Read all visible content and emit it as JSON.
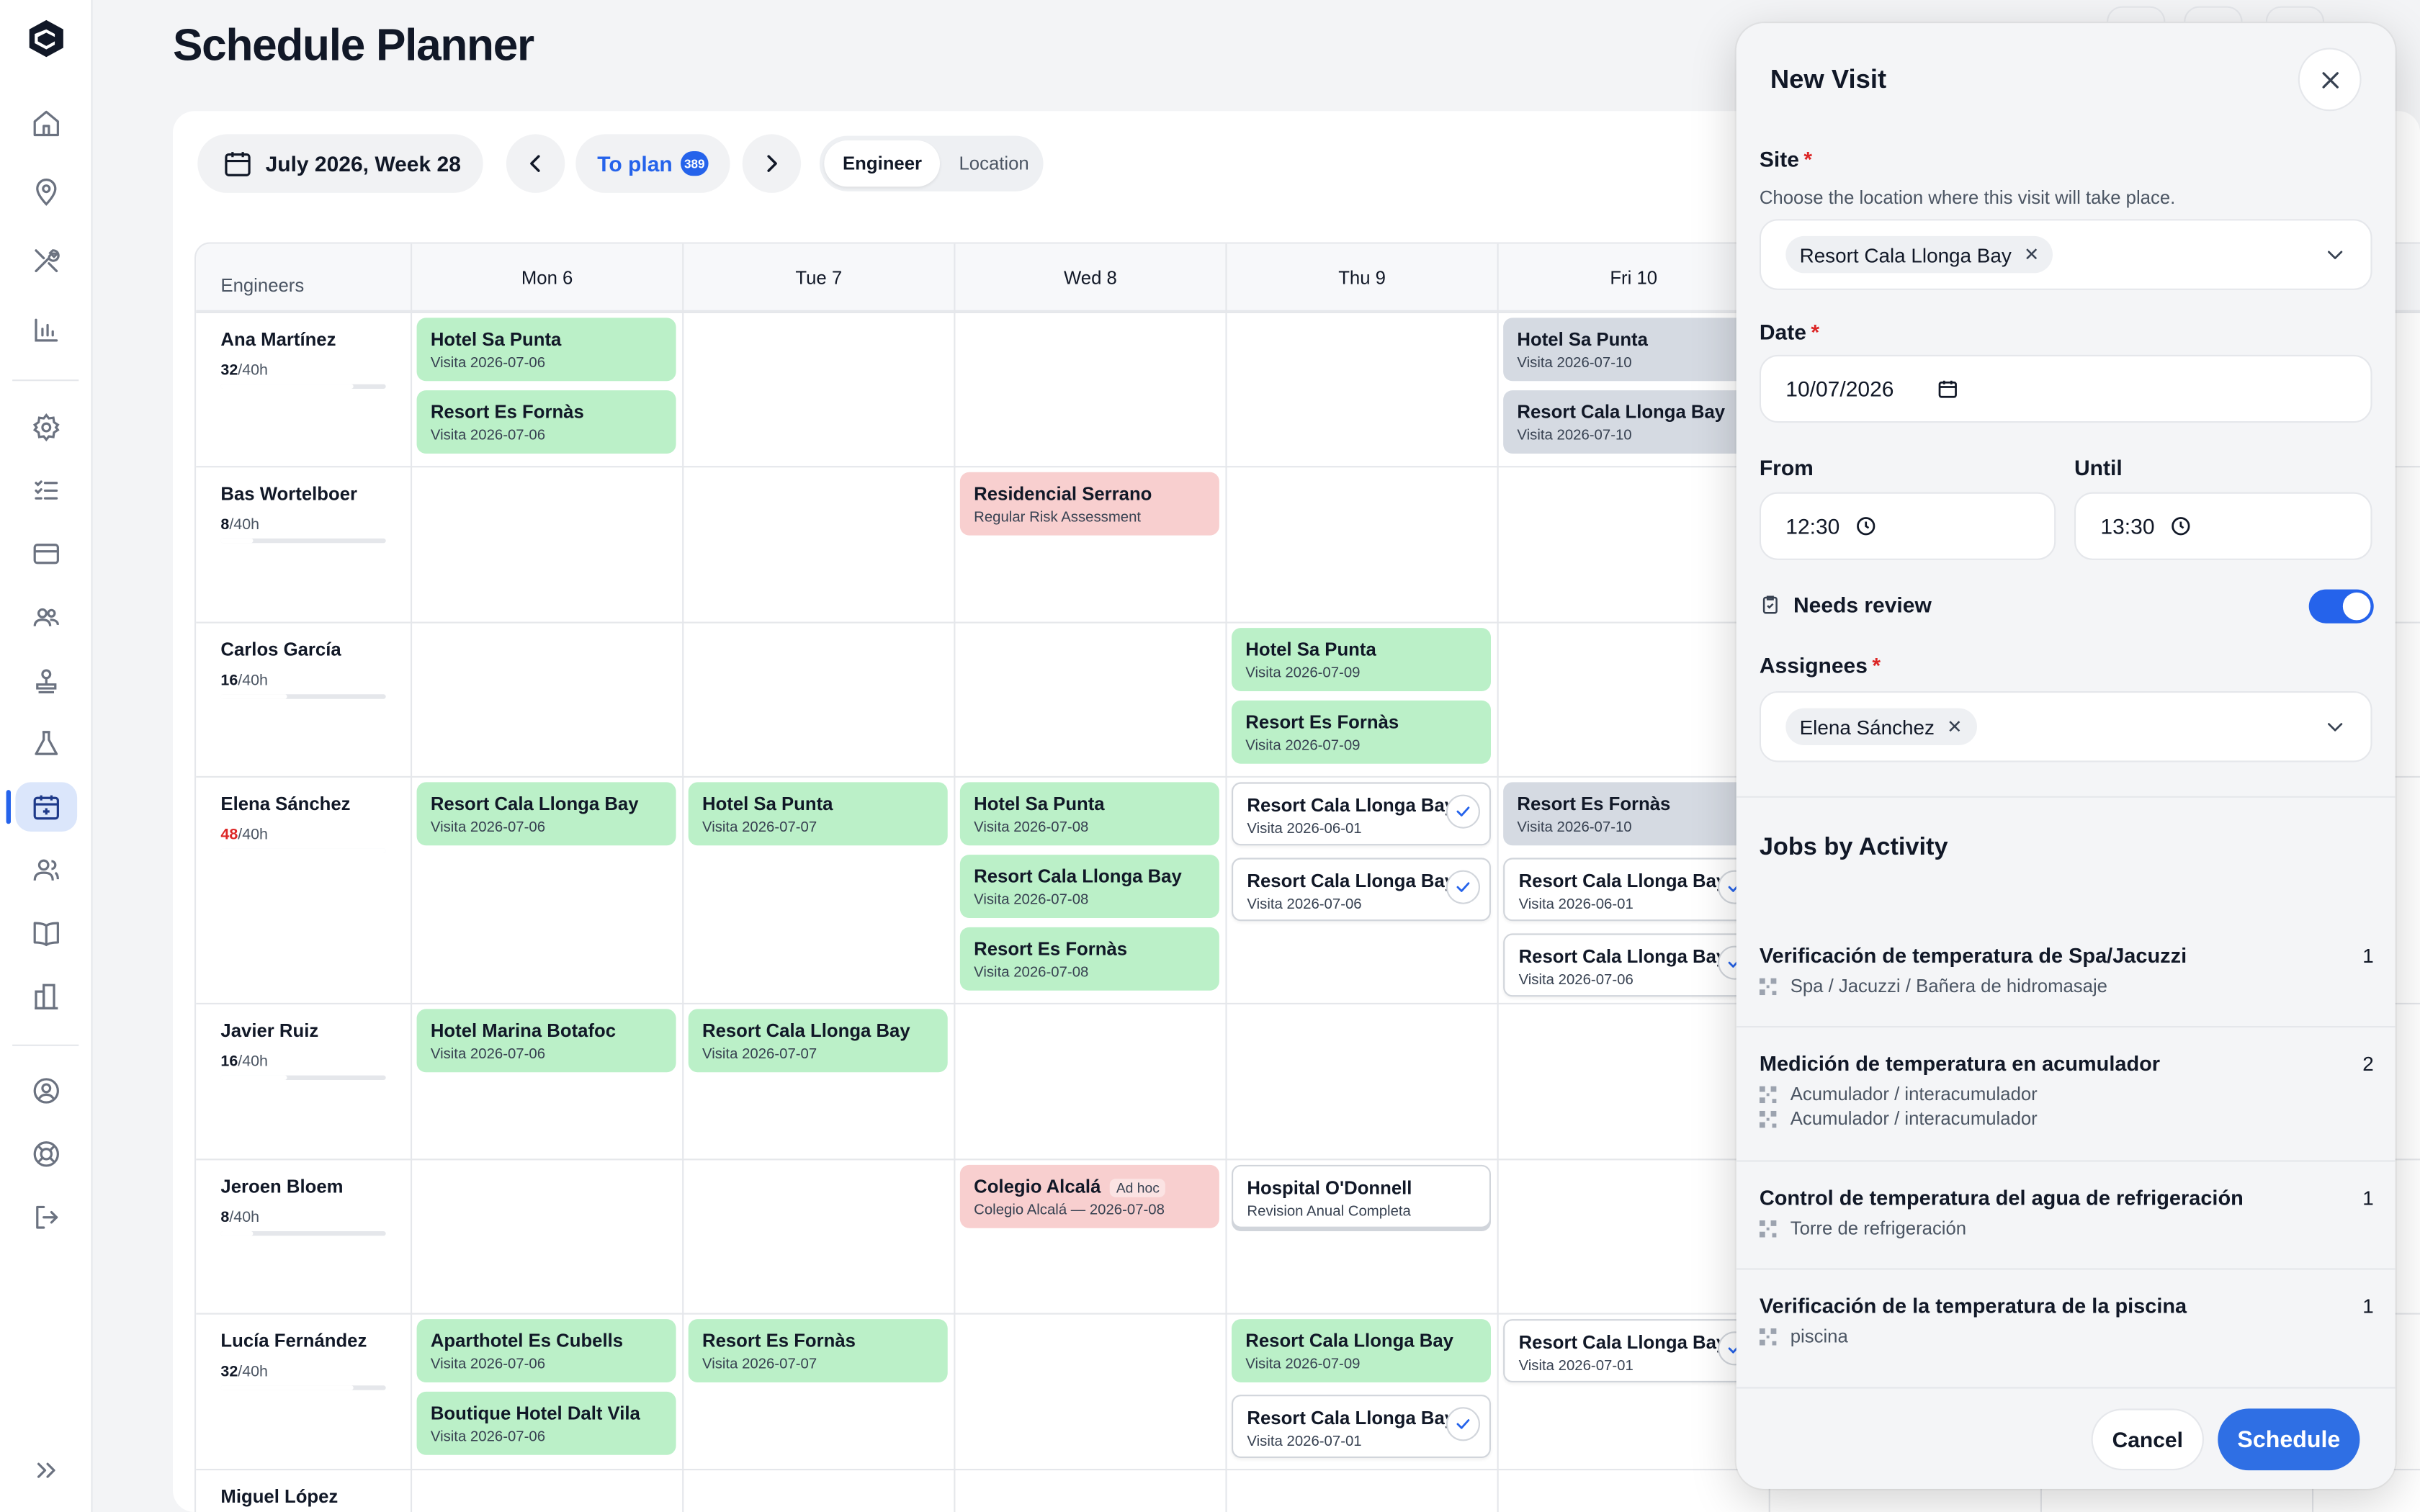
{
  "page": {
    "title": "Schedule Planner"
  },
  "toolbar": {
    "week_label": "July 2026, Week 28",
    "to_plan_label": "To plan",
    "to_plan_count": "389",
    "view_options": [
      "Engineer",
      "Location"
    ],
    "active_view": "Engineer"
  },
  "grid": {
    "engineers_header": "Engineers",
    "days": [
      "Mon 6",
      "Tue 7",
      "Wed 8",
      "Thu 9",
      "Fri 10"
    ],
    "engineers": [
      {
        "name": "Ana Martínez",
        "hours": "32",
        "capacity": "/40h",
        "over": false,
        "load_fraction": 0.8
      },
      {
        "name": "Bas Wortelboer",
        "hours": "8",
        "capacity": "/40h",
        "over": false,
        "load_fraction": 0.2
      },
      {
        "name": "Carlos García",
        "hours": "16",
        "capacity": "/40h",
        "over": false,
        "load_fraction": 0.4
      },
      {
        "name": "Elena Sánchez",
        "hours": "48",
        "capacity": "/40h",
        "over": true,
        "load_fraction": 1.0
      },
      {
        "name": "Javier Ruiz",
        "hours": "16",
        "capacity": "/40h",
        "over": false,
        "load_fraction": 0.4
      },
      {
        "name": "Jeroen Bloem",
        "hours": "8",
        "capacity": "/40h",
        "over": false,
        "load_fraction": 0.2
      },
      {
        "name": "Lucía Fernández",
        "hours": "32",
        "capacity": "/40h",
        "over": false,
        "load_fraction": 0.8
      },
      {
        "name": "Miguel López",
        "hours": "",
        "capacity": "",
        "over": false,
        "load_fraction": 0
      }
    ],
    "events": [
      {
        "row": 0,
        "col": 0,
        "slot": 0,
        "title": "Hotel Sa Punta",
        "sub": "Visita 2026-07-06",
        "style": "green"
      },
      {
        "row": 0,
        "col": 0,
        "slot": 1,
        "title": "Resort Es Fornàs",
        "sub": "Visita 2026-07-06",
        "style": "green"
      },
      {
        "row": 0,
        "col": 4,
        "slot": 0,
        "title": "Hotel Sa Punta",
        "sub": "Visita 2026-07-10",
        "style": "gray"
      },
      {
        "row": 0,
        "col": 4,
        "slot": 1,
        "title": "Resort Cala Llonga Bay",
        "sub": "Visita 2026-07-10",
        "style": "gray"
      },
      {
        "row": 1,
        "col": 2,
        "slot": 0,
        "title": "Residencial Serrano",
        "sub": "Regular Risk Assessment",
        "style": "red"
      },
      {
        "row": 2,
        "col": 3,
        "slot": 0,
        "title": "Hotel Sa Punta",
        "sub": "Visita 2026-07-09",
        "style": "green"
      },
      {
        "row": 2,
        "col": 3,
        "slot": 1,
        "title": "Resort Es Fornàs",
        "sub": "Visita 2026-07-09",
        "style": "green"
      },
      {
        "row": 3,
        "col": 0,
        "slot": 0,
        "title": "Resort Cala Llonga Bay",
        "sub": "Visita 2026-07-06",
        "style": "green"
      },
      {
        "row": 3,
        "col": 1,
        "slot": 0,
        "title": "Hotel Sa Punta",
        "sub": "Visita 2026-07-07",
        "style": "green"
      },
      {
        "row": 3,
        "col": 2,
        "slot": 0,
        "title": "Hotel Sa Punta",
        "sub": "Visita 2026-07-08",
        "style": "green"
      },
      {
        "row": 3,
        "col": 2,
        "slot": 1,
        "title": "Resort Cala Llonga Bay",
        "sub": "Visita 2026-07-08",
        "style": "green"
      },
      {
        "row": 3,
        "col": 2,
        "slot": 2,
        "title": "Resort Es Fornàs",
        "sub": "Visita 2026-07-08",
        "style": "green"
      },
      {
        "row": 3,
        "col": 3,
        "slot": 0,
        "title": "Resort Cala Llonga Bay",
        "sub": "Visita 2026-06-01",
        "style": "white",
        "check": true
      },
      {
        "row": 3,
        "col": 3,
        "slot": 1,
        "title": "Resort Cala Llonga Bay",
        "sub": "Visita 2026-07-06",
        "style": "white",
        "check": true
      },
      {
        "row": 3,
        "col": 4,
        "slot": 0,
        "title": "Resort Es Fornàs",
        "sub": "Visita 2026-07-10",
        "style": "gray"
      },
      {
        "row": 3,
        "col": 4,
        "slot": 1,
        "title": "Resort Cala Llonga Bay",
        "sub": "Visita 2026-06-01",
        "style": "white",
        "check": true
      },
      {
        "row": 3,
        "col": 4,
        "slot": 2,
        "title": "Resort Cala Llonga Bay",
        "sub": "Visita 2026-07-06",
        "style": "white",
        "check": true
      },
      {
        "row": 4,
        "col": 0,
        "slot": 0,
        "title": "Hotel Marina Botafoc",
        "sub": "Visita 2026-07-06",
        "style": "green"
      },
      {
        "row": 4,
        "col": 1,
        "slot": 0,
        "title": "Resort Cala Llonga Bay",
        "sub": "Visita 2026-07-07",
        "style": "green"
      },
      {
        "row": 5,
        "col": 2,
        "slot": 0,
        "title": "Colegio Alcalá",
        "sub": "Colegio Alcalá — 2026-07-08",
        "style": "red",
        "tag": "Ad hoc"
      },
      {
        "row": 5,
        "col": 3,
        "slot": 0,
        "title": "Hospital O'Donnell",
        "sub": "Revision Anual Completa",
        "style": "white"
      },
      {
        "row": 6,
        "col": 0,
        "slot": 0,
        "title": "Aparthotel Es Cubells",
        "sub": "Visita 2026-07-06",
        "style": "green"
      },
      {
        "row": 6,
        "col": 0,
        "slot": 1,
        "title": "Boutique Hotel Dalt Vila",
        "sub": "Visita 2026-07-06",
        "style": "green"
      },
      {
        "row": 6,
        "col": 1,
        "slot": 0,
        "title": "Resort Es Fornàs",
        "sub": "Visita 2026-07-07",
        "style": "green"
      },
      {
        "row": 6,
        "col": 3,
        "slot": 0,
        "title": "Resort Cala Llonga Bay",
        "sub": "Visita 2026-07-09",
        "style": "green"
      },
      {
        "row": 6,
        "col": 3,
        "slot": 1,
        "title": "Resort Cala Llonga Bay",
        "sub": "Visita 2026-07-01",
        "style": "white",
        "check": true
      },
      {
        "row": 6,
        "col": 4,
        "slot": 0,
        "title": "Resort Cala Llonga Bay",
        "sub": "Visita 2026-07-01",
        "style": "white",
        "check": true
      }
    ]
  },
  "drawer": {
    "title": "New Visit",
    "site_label": "Site",
    "site_hint": "Choose the location where this visit will take place.",
    "site_value": "Resort Cala Llonga Bay",
    "date_label": "Date",
    "date_value": "10/07/2026",
    "from_label": "From",
    "from_value": "12:30",
    "until_label": "Until",
    "until_value": "13:30",
    "needs_review_label": "Needs review",
    "needs_review_on": true,
    "assignees_label": "Assignees",
    "assignee_value": "Elena Sánchez",
    "jobs_title": "Jobs by Activity",
    "jobs": [
      {
        "title": "Verificación de temperatura de Spa/Jacuzzi",
        "count": "1",
        "items": [
          "Spa / Jacuzzi / Bañera de hidromasaje"
        ]
      },
      {
        "title": "Medición de temperatura en acumulador",
        "count": "2",
        "items": [
          "Acumulador / interacumulador",
          "Acumulador / interacumulador"
        ]
      },
      {
        "title": "Control de temperatura del agua de refrigeración",
        "count": "1",
        "items": [
          "Torre de refrigeración"
        ]
      },
      {
        "title": "Verificación de la temperatura de la piscina",
        "count": "1",
        "items": [
          "piscina"
        ]
      }
    ],
    "cancel_label": "Cancel",
    "schedule_label": "Schedule"
  },
  "colors": {
    "accent": "#2563eb",
    "event_green": "#bbf0c8",
    "event_gray": "#d5dae2",
    "event_red": "#f8cfcf",
    "over_capacity": "#dc2626"
  }
}
